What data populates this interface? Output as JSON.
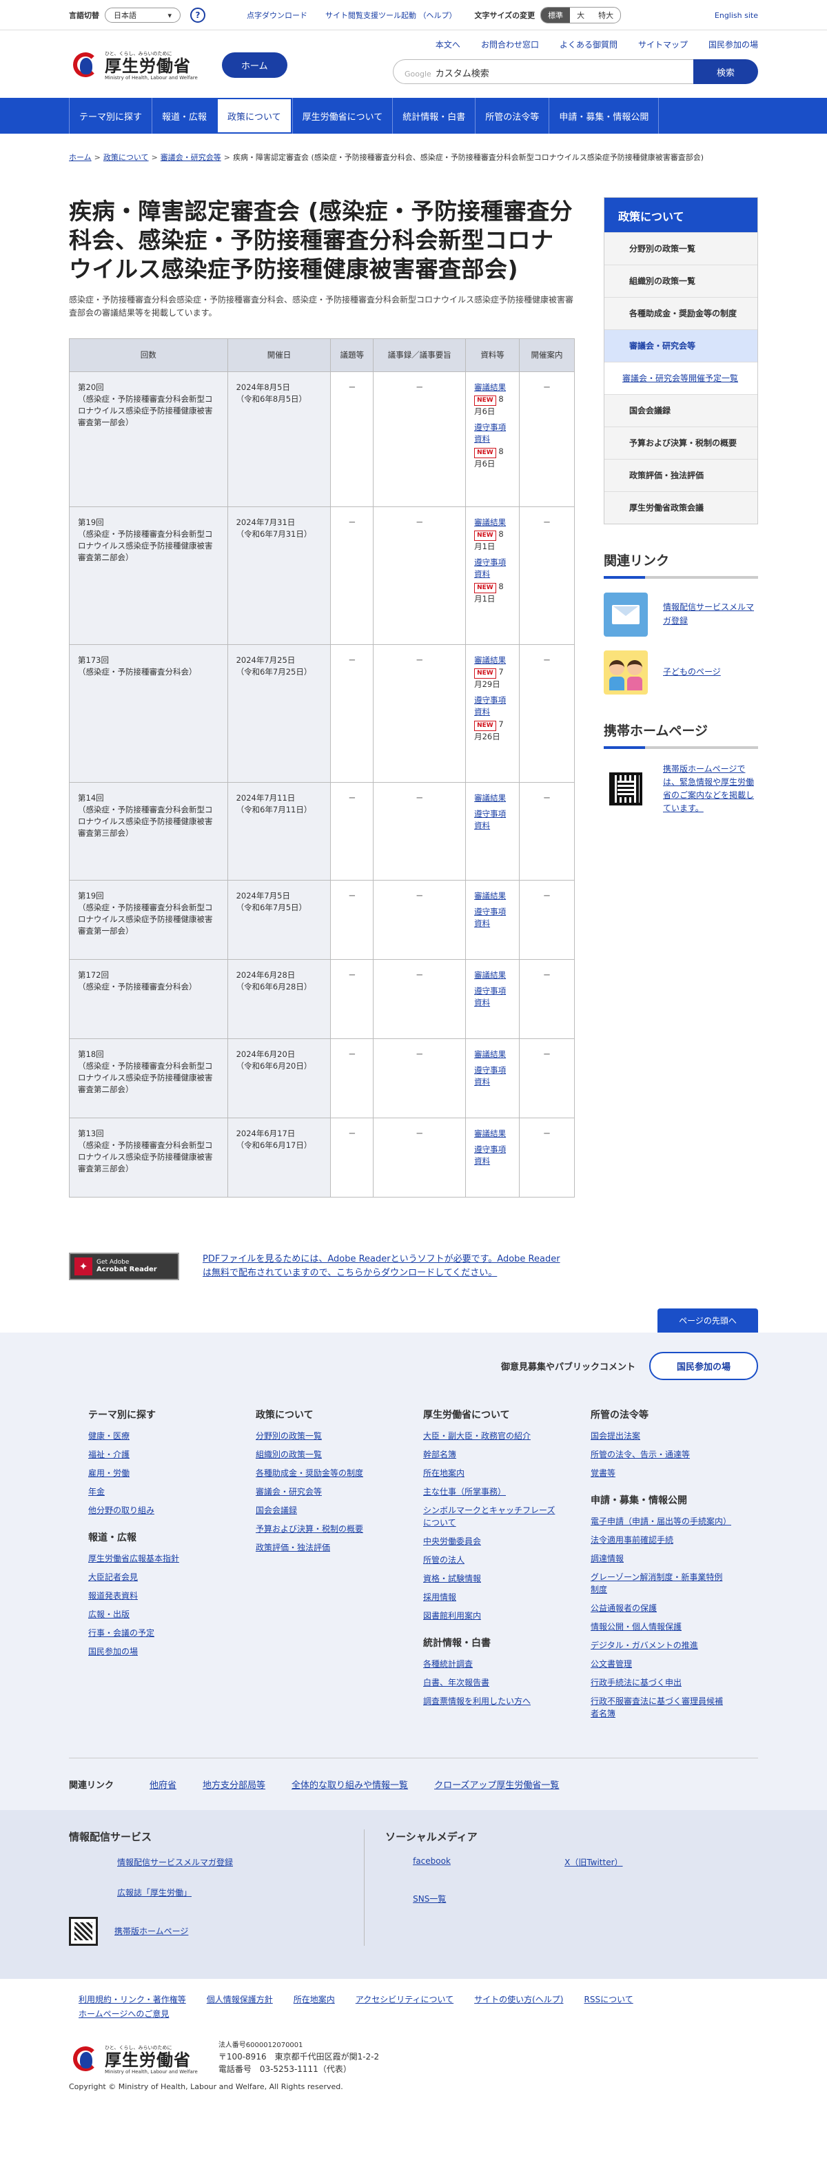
{
  "topbar": {
    "lang_label": "言語切替",
    "lang_value": "日本語",
    "help": "?",
    "links": [
      "点字ダウンロード",
      "サイト閲覧支援ツール起動 （ヘルプ）"
    ],
    "size_label": "文字サイズの変更",
    "sizes": [
      "標準",
      "大",
      "特大"
    ],
    "english": "English site"
  },
  "header": {
    "logo_small": "ひと、くらし、みらいのために",
    "logo_big": "厚生労働省",
    "logo_en": "Ministry of Health, Labour and Welfare",
    "home": "ホーム",
    "links": [
      "本文へ",
      "お問合わせ窓口",
      "よくある御質問",
      "サイトマップ",
      "国民参加の場"
    ],
    "search_google": "Google",
    "search_placeholder": "カスタム検索",
    "search_btn": "検索"
  },
  "nav": [
    "テーマ別に探す",
    "報道・広報",
    "政策について",
    "厚生労働省について",
    "統計情報・白書",
    "所管の法令等",
    "申請・募集・情報公開"
  ],
  "breadcrumb": [
    "ホーム",
    "政策について",
    "審議会・研究会等",
    "疾病・障害認定審査会 (感染症・予防接種審査分科会、感染症・予防接種審査分科会新型コロナウイルス感染症予防接種健康被害審査部会)"
  ],
  "page": {
    "title": "疾病・障害認定審査会 (感染症・予防接種審査分科会、感染症・予防接種審査分科会新型コロナウイルス感染症予防接種健康被害審査部会)",
    "lead": "感染症・予防接種審査分科会感染症・予防接種審査分科会、感染症・予防接種審査分科会新型コロナウイルス感染症予防接種健康被害審査部会の審議結果等を掲載しています。"
  },
  "table": {
    "headers": [
      "回数",
      "開催日",
      "議題等",
      "議事録／議事要旨",
      "資料等",
      "開催案内"
    ],
    "rows": [
      {
        "kai": "第20回",
        "body": "（感染症・予防接種審査分科会新型コロナウイルス感染症予防接種健康被害審査第一部会）",
        "date": "2024年8月5日",
        "wareki": "（令和6年8月5日）",
        "gidai": "－",
        "gijiroku": "－",
        "doc1": "審議結果",
        "new1": "NEW",
        "d1": "8月6日",
        "doc2": "遵守事項資料",
        "new2": "NEW",
        "d2": "8月6日",
        "annai": "－"
      },
      {
        "kai": "第19回",
        "body": "（感染症・予防接種審査分科会新型コロナウイルス感染症予防接種健康被害審査第二部会）",
        "date": "2024年7月31日",
        "wareki": "（令和6年7月31日）",
        "gidai": "－",
        "gijiroku": "－",
        "doc1": "審議結果",
        "new1": "NEW",
        "d1": "8月1日",
        "doc2": "遵守事項資料",
        "new2": "NEW",
        "d2": "8月1日",
        "annai": "－"
      },
      {
        "kai": "第173回",
        "body": "（感染症・予防接種審査分科会）",
        "date": "2024年7月25日",
        "wareki": "（令和6年7月25日）",
        "gidai": "－",
        "gijiroku": "－",
        "doc1": "審議結果",
        "new1": "NEW",
        "d1": "7月29日",
        "doc2": "遵守事項資料",
        "new2": "NEW",
        "d2": "7月26日",
        "annai": "－"
      },
      {
        "kai": "第14回",
        "body": "（感染症・予防接種審査分科会新型コロナウイルス感染症予防接種健康被害審査第三部会）",
        "date": "2024年7月11日",
        "wareki": "（令和6年7月11日）",
        "gidai": "－",
        "gijiroku": "－",
        "doc1": "審議結果",
        "doc2": "遵守事項資料",
        "annai": "－"
      },
      {
        "kai": "第19回",
        "body": "（感染症・予防接種審査分科会新型コロナウイルス感染症予防接種健康被害審査第一部会）",
        "date": "2024年7月5日",
        "wareki": "（令和6年7月5日）",
        "gidai": "－",
        "gijiroku": "－",
        "doc1": "審議結果",
        "doc2": "遵守事項資料",
        "annai": "－"
      },
      {
        "kai": "第172回",
        "body": "（感染症・予防接種審査分科会）",
        "date": "2024年6月28日",
        "wareki": "（令和6年6月28日）",
        "gidai": "－",
        "gijiroku": "－",
        "doc1": "審議結果",
        "doc2": "遵守事項資料",
        "annai": "－"
      },
      {
        "kai": "第18回",
        "body": "（感染症・予防接種審査分科会新型コロナウイルス感染症予防接種健康被害審査第二部会）",
        "date": "2024年6月20日",
        "wareki": "（令和6年6月20日）",
        "gidai": "－",
        "gijiroku": "－",
        "doc1": "審議結果",
        "doc2": "遵守事項資料",
        "annai": "－"
      },
      {
        "kai": "第13回",
        "body": "（感染症・予防接種審査分科会新型コロナウイルス感染症予防接種健康被害審査第三部会）",
        "date": "2024年6月17日",
        "wareki": "（令和6年6月17日）",
        "gidai": "－",
        "gijiroku": "－",
        "doc1": "審議結果",
        "doc2": "遵守事項資料",
        "annai": "－"
      }
    ]
  },
  "sidebar": {
    "head": "政策について",
    "items": [
      "分野別の政策一覧",
      "組織別の政策一覧",
      "各種助成金・奨励金等の制度",
      "審議会・研究会等",
      "審議会・研究会等開催予定一覧",
      "国会会議録",
      "予算および決算・税制の概要",
      "政策評価・独法評価",
      "厚生労働省政策会議"
    ],
    "related_title": "関連リンク",
    "related": [
      "情報配信サービスメルマガ登録",
      "子どものページ"
    ],
    "mobile_title": "携帯ホームページ",
    "mobile_text": "携帯版ホームページでは、緊急情報や厚生労働省のご案内などを掲載しています。"
  },
  "adobe": {
    "btn_line1": "Get Adobe",
    "btn_line2": "Acrobat Reader",
    "text": "PDFファイルを見るためには、Adobe Readerというソフトが必要です。Adobe Readerは無料で配布されていますので、こちらからダウンロードしてください。"
  },
  "totop": "ページの先頭へ",
  "footer": {
    "opinion_label": "御意見募集やパブリックコメント",
    "opinion_btn": "国民参加の場",
    "col1": {
      "h1": "テーマ別に探す",
      "l1": [
        "健康・医療",
        "福祉・介護",
        "雇用・労働",
        "年金",
        "他分野の取り組み"
      ],
      "h2": "報道・広報",
      "l2": [
        "厚生労働省広報基本指針",
        "大臣記者会見",
        "報道発表資料",
        "広報・出版",
        "行事・会議の予定",
        "国民参加の場"
      ]
    },
    "col2": {
      "h1": "政策について",
      "l1": [
        "分野別の政策一覧",
        "組織別の政策一覧",
        "各種助成金・奨励金等の制度",
        "審議会・研究会等",
        "国会会議録",
        "予算および決算・税制の概要",
        "政策評価・独法評価"
      ]
    },
    "col3": {
      "h1": "厚生労働省について",
      "l1": [
        "大臣・副大臣・政務官の紹介",
        "幹部名簿",
        "所在地案内",
        "主な仕事（所掌事務）",
        "シンボルマークとキャッチフレーズについて",
        "中央労働委員会",
        "所管の法人",
        "資格・試験情報",
        "採用情報",
        "図書館利用案内"
      ],
      "h2": "統計情報・白書",
      "l2": [
        "各種統計調査",
        "白書、年次報告書",
        "調査票情報を利用したい方へ"
      ]
    },
    "col4": {
      "h1": "所管の法令等",
      "l1": [
        "国会提出法案",
        "所管の法令、告示・通達等",
        "覚書等"
      ],
      "h2": "申請・募集・情報公開",
      "l2": [
        "電子申請（申請・届出等の手続案内）",
        "法令適用事前確認手続",
        "調達情報",
        "グレーゾーン解消制度・新事業特例制度",
        "公益通報者の保護",
        "情報公開・個人情報保護",
        "デジタル・ガバメントの推進",
        "公文書管理",
        "行政手続法に基づく申出",
        "行政不服審査法に基づく審理員候補者名簿"
      ]
    },
    "related_label": "関連リンク",
    "related": [
      "他府省",
      "地方支分部局等",
      "全体的な取り組みや情報一覧",
      "クローズアップ厚生労働省一覧"
    ],
    "info_title": "情報配信サービス",
    "info": [
      "情報配信サービスメルマガ登録",
      "広報誌「厚生労働」",
      "携帯版ホームページ"
    ],
    "sns_title": "ソーシャルメディア",
    "sns": [
      "facebook",
      "X（旧Twitter）",
      "SNS一覧"
    ],
    "bottom_links": [
      "利用規約・リンク・著作権等",
      "個人情報保護方針",
      "所在地案内",
      "アクセシビリティについて",
      "サイトの使い方(ヘルプ)",
      "RSSについて",
      "ホームページへのご意見"
    ],
    "corp_no": "法人番号6000012070001",
    "zip": "〒100-8916　東京都千代田区霞が関1-2-2",
    "tel": "電話番号　03-5253-1111（代表）",
    "copyright": "Copyright © Ministry of Health, Labour and Welfare, All Rights reserved."
  }
}
